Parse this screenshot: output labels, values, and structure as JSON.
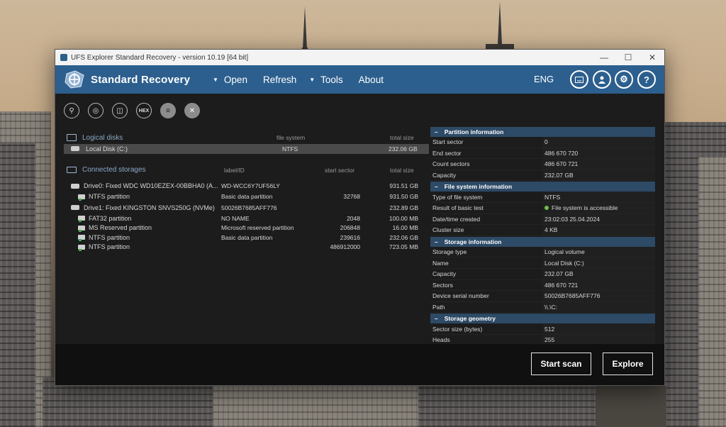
{
  "window": {
    "title": "UFS Explorer Standard Recovery - version 10.19 [64 bit]"
  },
  "menubar": {
    "logo_text": "Standard Recovery",
    "open": "Open",
    "refresh": "Refresh",
    "tools": "Tools",
    "about": "About",
    "lang": "ENG"
  },
  "toolbar": {
    "hex_label": "HEX"
  },
  "logical": {
    "title": "Logical disks",
    "col_fs": "file system",
    "col_size": "total size",
    "rows": [
      {
        "name": "Local Disk (C:)",
        "fs": "NTFS",
        "size": "232.06 GB"
      }
    ]
  },
  "storages": {
    "title": "Connected storages",
    "col_label": "label/ID",
    "col_start": "start sector",
    "col_size": "total size",
    "rows": [
      {
        "name": "Drive0: Fixed WDC WD10EZEX-00BBHA0 (A...",
        "label": "WD-WCC6Y7UF56LY",
        "start": "",
        "size": "931.51 GB"
      },
      {
        "name": "NTFS partition",
        "label": "Basic data partition",
        "start": "32768",
        "size": "931.50 GB"
      },
      {
        "name": "Drive1: Fixed KINGSTON SNVS250G (NVMe)",
        "label": "50026B7685AFF776",
        "start": "",
        "size": "232.89 GB"
      },
      {
        "name": "FAT32 partition",
        "label": "NO NAME",
        "start": "2048",
        "size": "100.00 MB"
      },
      {
        "name": "MS Reserved partition",
        "label": "Microsoft reserved partition",
        "start": "206848",
        "size": "16.00 MB"
      },
      {
        "name": "NTFS partition",
        "label": "Basic data partition",
        "start": "239616",
        "size": "232.06 GB"
      },
      {
        "name": "NTFS partition",
        "label": "",
        "start": "486912000",
        "size": "723.05 MB"
      }
    ]
  },
  "info": {
    "partition": {
      "title": "Partition information",
      "rows": [
        {
          "k": "Start sector",
          "v": "0"
        },
        {
          "k": "End sector",
          "v": "486 670 720"
        },
        {
          "k": "Count sectors",
          "v": "486 670 721"
        },
        {
          "k": "Capacity",
          "v": "232.07 GB"
        }
      ]
    },
    "filesystem": {
      "title": "File system information",
      "rows": [
        {
          "k": "Type of file system",
          "v": "NTFS"
        },
        {
          "k": "Result of basic test",
          "v": "File system is accessible"
        },
        {
          "k": "Date/time created",
          "v": "23:02:03 25.04.2024"
        },
        {
          "k": "Cluster size",
          "v": "4 KB"
        }
      ]
    },
    "storage": {
      "title": "Storage information",
      "rows": [
        {
          "k": "Storage type",
          "v": "Logical volume"
        },
        {
          "k": "Name",
          "v": "Local Disk (C:)"
        },
        {
          "k": "Capacity",
          "v": "232.07 GB"
        },
        {
          "k": "Sectors",
          "v": "486 670 721"
        },
        {
          "k": "Device serial number",
          "v": "50026B7685AFF776"
        },
        {
          "k": "Path",
          "v": "\\\\.\\C:"
        }
      ]
    },
    "geometry": {
      "title": "Storage geometry",
      "rows": [
        {
          "k": "Sector size (bytes)",
          "v": "512"
        },
        {
          "k": "Heads",
          "v": "255"
        }
      ]
    }
  },
  "footer": {
    "start_scan": "Start scan",
    "explore": "Explore"
  }
}
